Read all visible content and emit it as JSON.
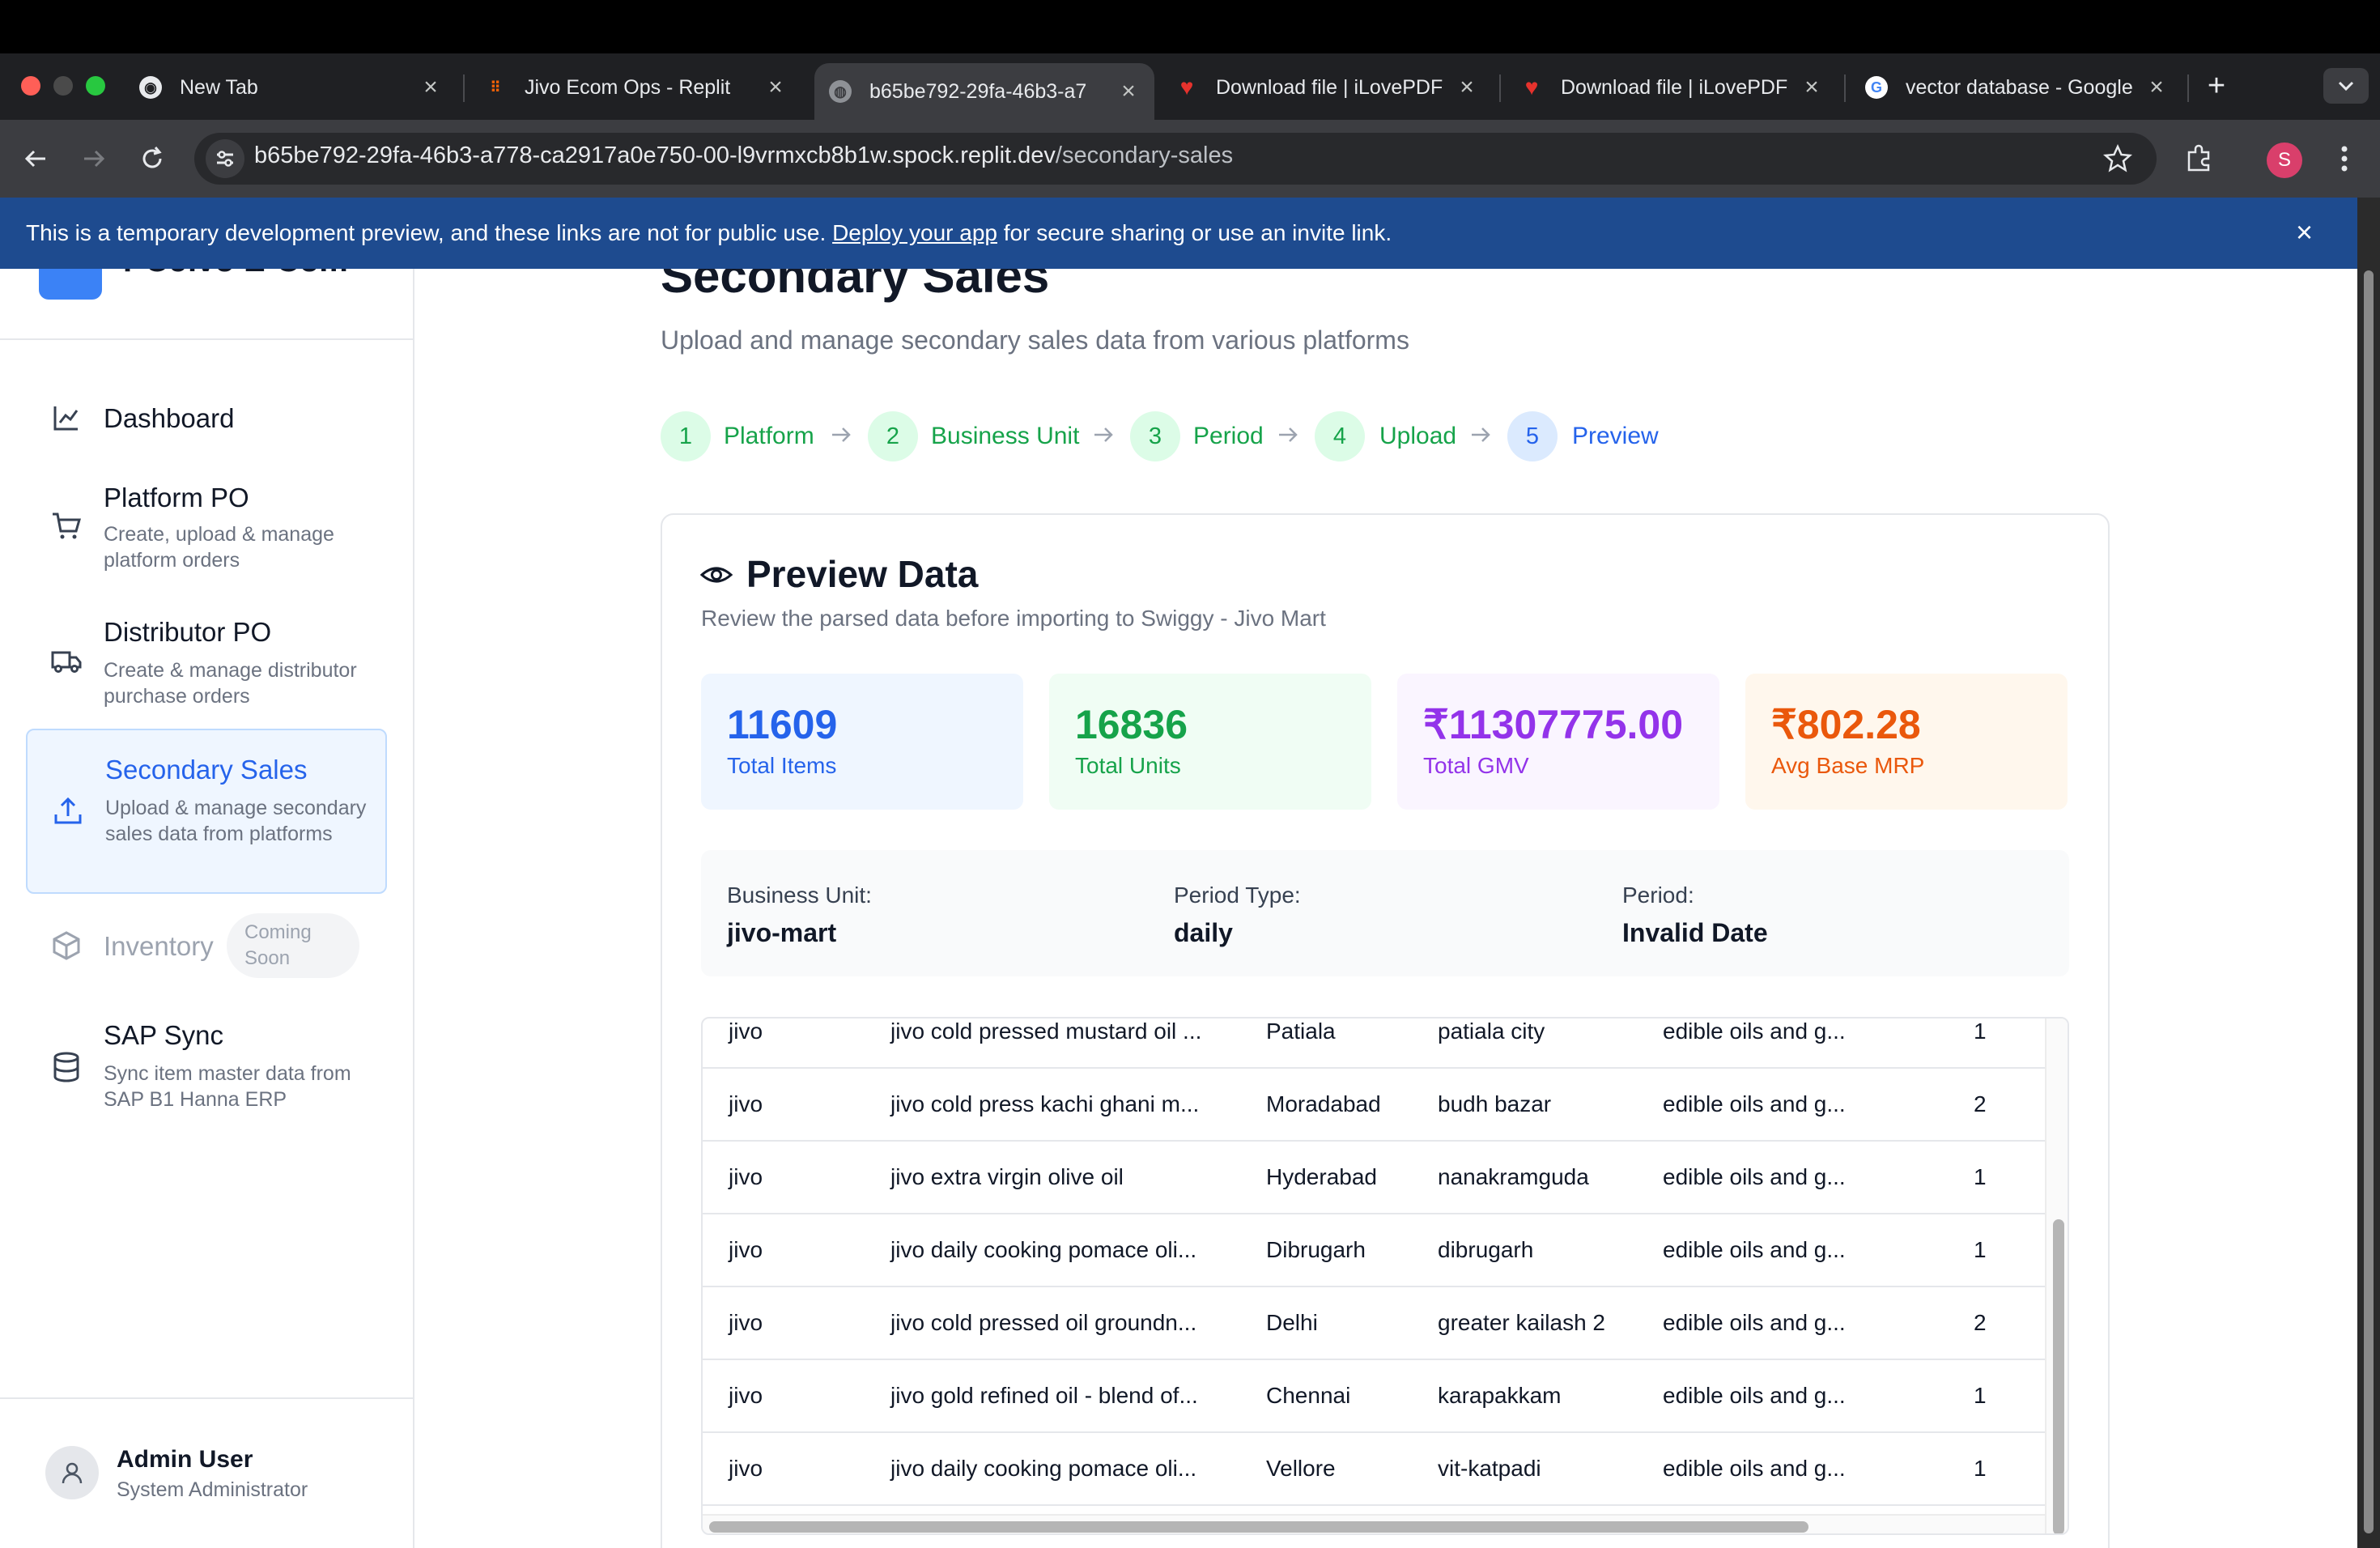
{
  "browser": {
    "tabs": [
      {
        "label": "New Tab",
        "icon": "chrome-icon"
      },
      {
        "label": "Jivo Ecom Ops - Replit",
        "icon": "replit-icon"
      },
      {
        "label": "b65be792-29fa-46b3-a7",
        "icon": "globe-icon"
      },
      {
        "label": "Download file | iLovePDF",
        "icon": "ilovepdf-icon"
      },
      {
        "label": "Download file | iLovePDF",
        "icon": "ilovepdf-icon"
      },
      {
        "label": "vector database - Google",
        "icon": "google-icon"
      }
    ],
    "url_host": "b65be792-29fa-46b3-a778-ca2917a0e750-00-l9vrmxcb8b1w.spock.replit.dev",
    "url_path": "/secondary-sales",
    "profile_initial": "S"
  },
  "banner": {
    "text_before": "This is a temporary development preview, and these links are not for public use. ",
    "link": "Deploy your app",
    "text_after": " for secure sharing or use an invite link."
  },
  "sidebar": {
    "brand": "POJivo E-Com",
    "items": [
      {
        "title": "Dashboard",
        "sub": ""
      },
      {
        "title": "Platform PO",
        "sub": "Create, upload & manage platform orders"
      },
      {
        "title": "Distributor PO",
        "sub": "Create & manage distributor purchase orders"
      },
      {
        "title": "Secondary Sales",
        "sub": "Upload & manage secondary sales data from platforms"
      },
      {
        "title": "Inventory",
        "sub": "",
        "badge": "Coming Soon"
      },
      {
        "title": "SAP Sync",
        "sub": "Sync item master data from SAP B1 Hanna ERP"
      }
    ],
    "user": {
      "name": "Admin User",
      "role": "System Administrator"
    }
  },
  "page": {
    "title": "Secondary Sales",
    "subtitle": "Upload and manage secondary sales data from various platforms",
    "steps": [
      {
        "num": "1",
        "label": "Platform"
      },
      {
        "num": "2",
        "label": "Business Unit"
      },
      {
        "num": "3",
        "label": "Period"
      },
      {
        "num": "4",
        "label": "Upload"
      },
      {
        "num": "5",
        "label": "Preview"
      }
    ]
  },
  "preview": {
    "title": "Preview Data",
    "subtitle": "Review the parsed data before importing to Swiggy - Jivo Mart",
    "stats": [
      {
        "value": "11609",
        "label": "Total Items",
        "color": "#2563eb"
      },
      {
        "value": "16836",
        "label": "Total Units",
        "color": "#16a34a"
      },
      {
        "value": "₹11307775.00",
        "label": "Total GMV",
        "color": "#9333ea"
      },
      {
        "value": "₹802.28",
        "label": "Avg Base MRP",
        "color": "#ea580c"
      }
    ],
    "meta": [
      {
        "label": "Business Unit:",
        "value": "jivo-mart"
      },
      {
        "label": "Period Type:",
        "value": "daily"
      },
      {
        "label": "Period:",
        "value": "Invalid Date"
      }
    ],
    "rows": [
      [
        "jivo",
        "jivo cold pressed mustard oil ...",
        "Patiala",
        "patiala city",
        "edible oils and g...",
        "1"
      ],
      [
        "jivo",
        "jivo cold press kachi ghani m...",
        "Moradabad",
        "budh bazar",
        "edible oils and g...",
        "2"
      ],
      [
        "jivo",
        "jivo extra virgin olive oil",
        "Hyderabad",
        "nanakramguda",
        "edible oils and g...",
        "1"
      ],
      [
        "jivo",
        "jivo daily cooking pomace oli...",
        "Dibrugarh",
        "dibrugarh",
        "edible oils and g...",
        "1"
      ],
      [
        "jivo",
        "jivo cold pressed oil groundn...",
        "Delhi",
        "greater kailash 2",
        "edible oils and g...",
        "2"
      ],
      [
        "jivo",
        "jivo gold refined oil - blend of...",
        "Chennai",
        "karapakkam",
        "edible oils and g...",
        "1"
      ],
      [
        "jivo",
        "jivo daily cooking pomace oli...",
        "Vellore",
        "vit-katpadi",
        "edible oils and g...",
        "1"
      ]
    ]
  }
}
